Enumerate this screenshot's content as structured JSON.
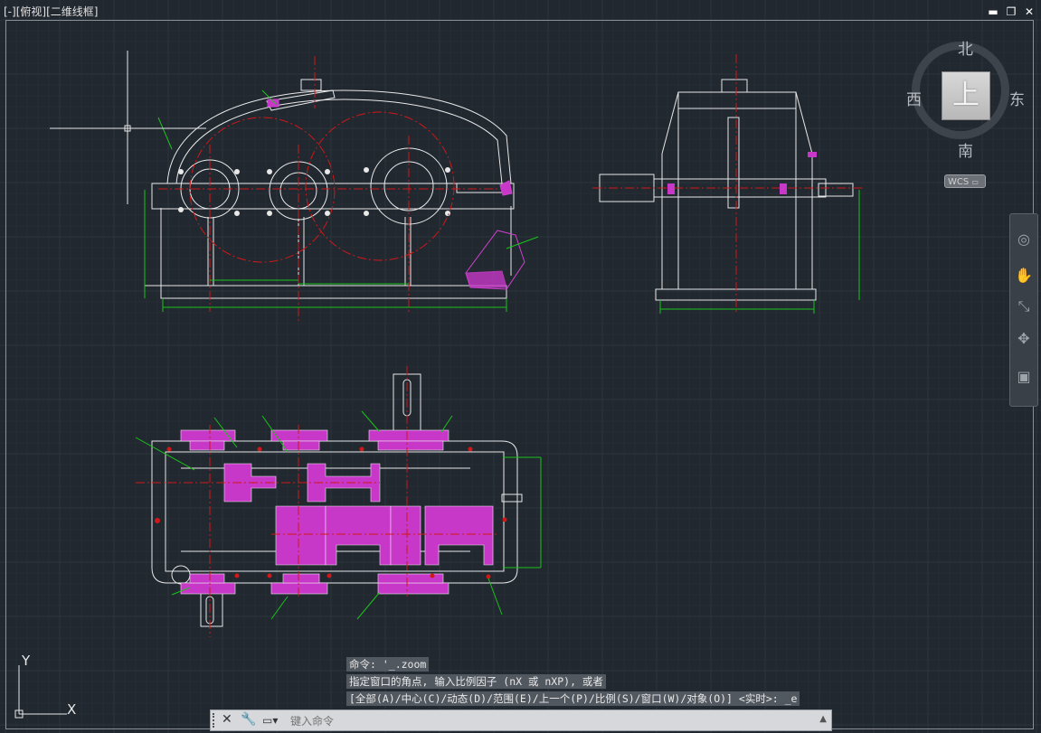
{
  "viewport": {
    "label_view_box": "[-]",
    "label_view": "[俯视]",
    "label_style": "[二维线框]"
  },
  "window_controls": {
    "minimize": "▬",
    "restore": "❐",
    "close": "✕"
  },
  "viewcube": {
    "face": "上",
    "north": "北",
    "south": "南",
    "east": "东",
    "west": "西",
    "wcs": "WCS"
  },
  "ucs": {
    "x": "X",
    "y": "Y"
  },
  "command_history": [
    "命令: '_.zoom",
    "指定窗口的角点, 输入比例因子 (nX 或 nXP), 或者",
    "[全部(A)/中心(C)/动态(D)/范围(E)/上一个(P)/比例(S)/窗口(W)/对象(O)] <实时>: _e"
  ],
  "command_input": {
    "placeholder": "键入命令"
  },
  "colors": {
    "background": "#212830",
    "linework": "#e8e8e8",
    "centerline": "#d01818",
    "dimension": "#19c419",
    "hatch": "#d040d0"
  }
}
